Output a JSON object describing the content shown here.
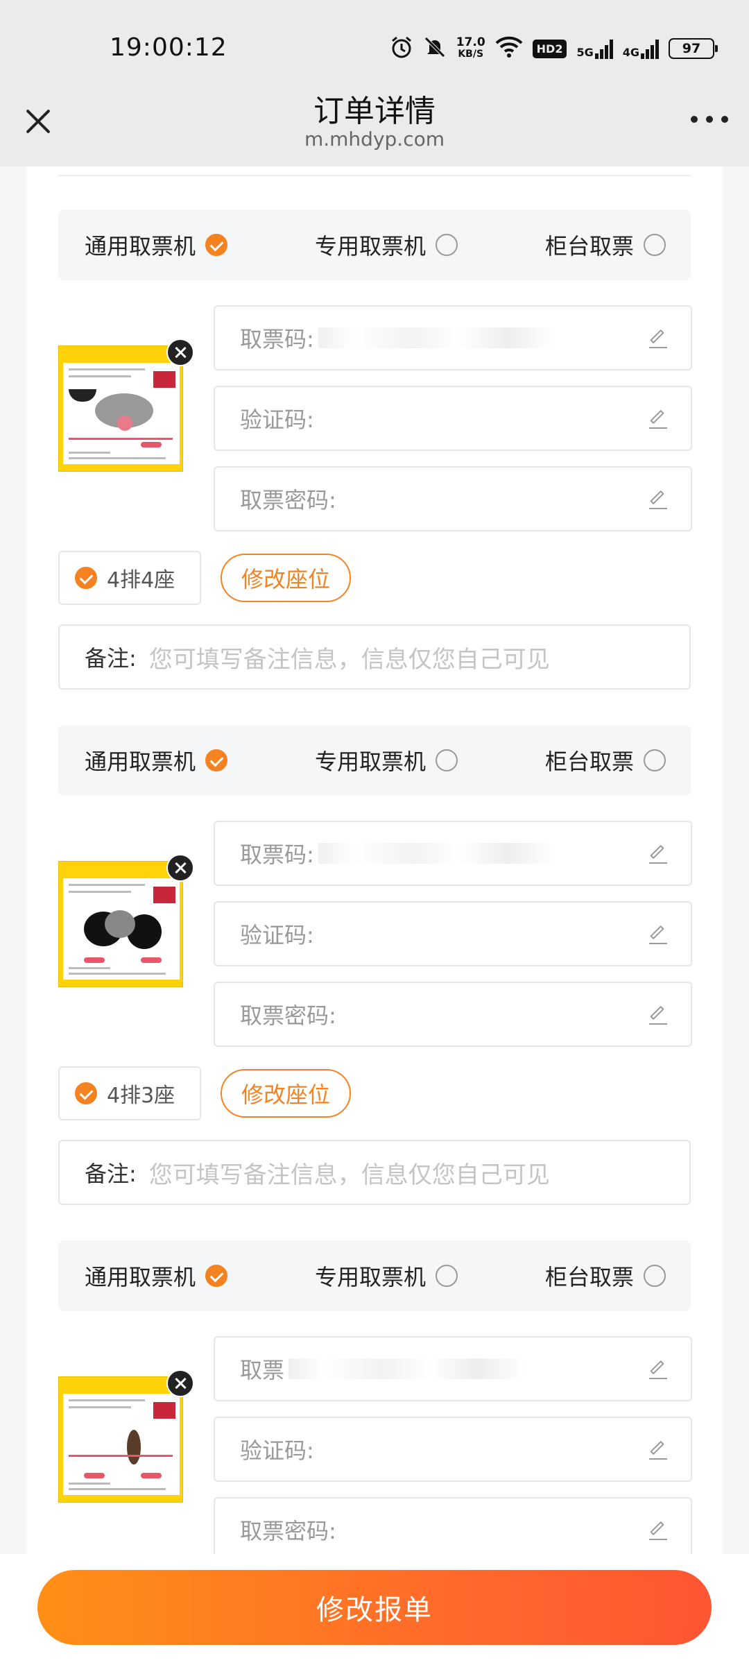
{
  "status_bar": {
    "time": "19:00:12",
    "speed_value": "17.0",
    "speed_unit": "KB/S",
    "hd_label": "HD2",
    "net1": "5G",
    "net2": "4G",
    "battery": "97"
  },
  "nav": {
    "title": "订单详情",
    "subtitle": "m.mhdyp.com"
  },
  "options": {
    "general": "通用取票机",
    "dedicated": "专用取票机",
    "counter": "柜台取票"
  },
  "fields": {
    "ticket_code": "取票码:",
    "ticket_code_partial": "取票",
    "verify_code": "验证码:",
    "ticket_password": "取票密码:"
  },
  "modify_seat_label": "修改座位",
  "remark": {
    "label": "备注:",
    "placeholder": "您可填写备注信息，信息仅您自己可见"
  },
  "tickets": [
    {
      "seat": "4排4座",
      "selected_option": "general"
    },
    {
      "seat": "4排3座",
      "selected_option": "general"
    },
    {
      "seat": "",
      "selected_option": "general"
    }
  ],
  "submit_label": "修改报单",
  "colors": {
    "accent": "#f58220",
    "button_start": "#ff8f16",
    "button_end": "#ff5533"
  }
}
